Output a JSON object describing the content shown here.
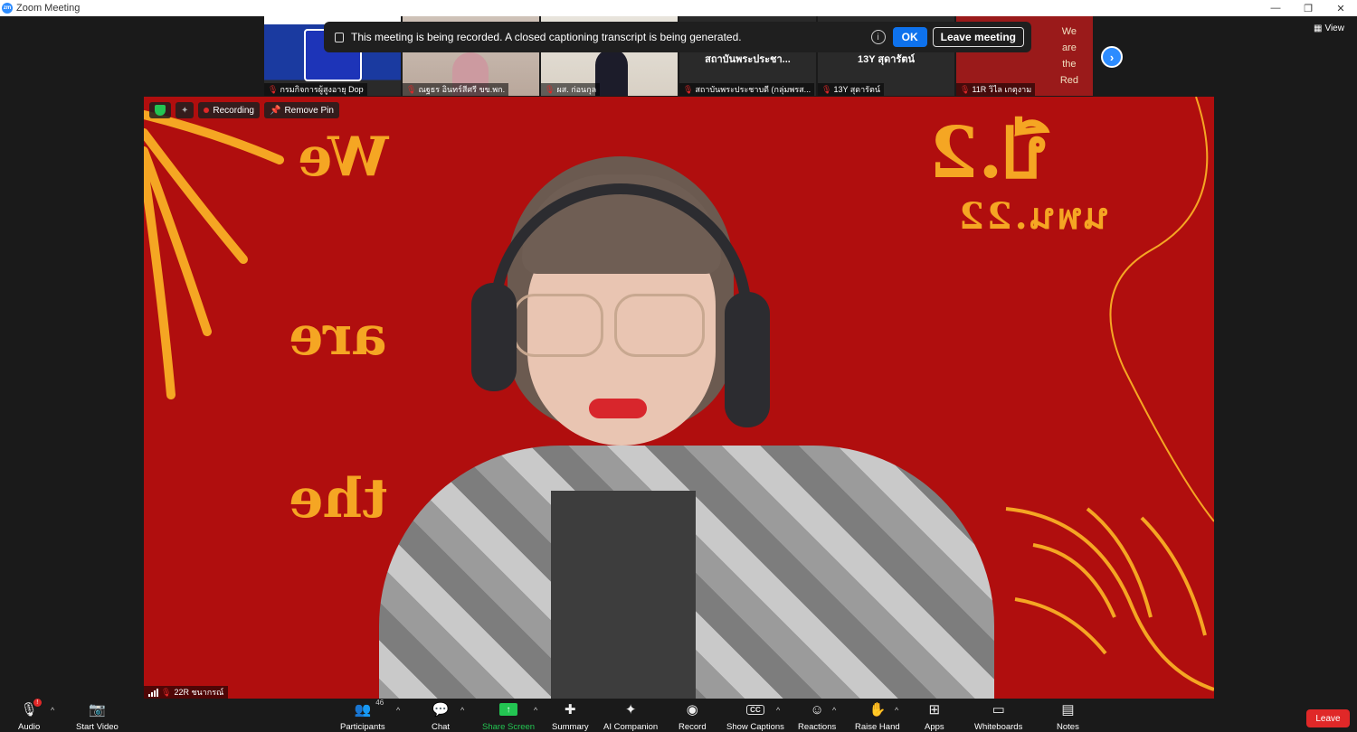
{
  "window": {
    "title": "Zoom Meeting",
    "app_icon_text": "zm",
    "controls": {
      "minimize": "—",
      "restore": "❐",
      "close": "✕"
    }
  },
  "recording_notice": {
    "message": "This meeting is being recorded. A closed captioning transcript is being generated.",
    "info_icon": "i",
    "ok_label": "OK",
    "leave_label": "Leave meeting"
  },
  "gallery": {
    "thumbnails": [
      {
        "name": "กรมกิจการผู้สูงอายุ Dop",
        "muted": true
      },
      {
        "name": "ณฐธร อินทร์สีศรี ขข.พก.",
        "muted": true
      },
      {
        "name": "ผส. ก่อนกุล",
        "muted": true
      },
      {
        "name": "สถาบันพระประชาบดี (กลุ่มพรส...",
        "muted": true,
        "big_name": "สถาบันพระประชา..."
      },
      {
        "name": "13Y สุดารัตน์",
        "muted": true,
        "big_name": "13Y สุดารัตน์"
      },
      {
        "name": "11R วิไล เกตุงาม",
        "muted": true,
        "overlay_text": [
          "We",
          "are",
          "the",
          "Red"
        ]
      }
    ],
    "next_icon": "›",
    "view_label": "View"
  },
  "main_video": {
    "background_words": [
      "We",
      "are",
      "the",
      "ปี.2",
      "นพน.22"
    ],
    "badges": {
      "recording_label": "Recording",
      "remove_pin_label": "Remove Pin"
    },
    "participant_name": "22R ชนากรณ์"
  },
  "toolbar": {
    "audio": {
      "label": "Audio",
      "icon": "🎙",
      "badge": "!"
    },
    "start_video": {
      "label": "Start Video",
      "icon": "📷"
    },
    "participants": {
      "label": "Participants",
      "icon": "👥",
      "count": "46"
    },
    "chat": {
      "label": "Chat",
      "icon": "💬"
    },
    "share_screen": {
      "label": "Share Screen",
      "icon": "↑"
    },
    "summary": {
      "label": "Summary",
      "icon": "✚"
    },
    "ai_companion": {
      "label": "AI Companion",
      "icon": "✦"
    },
    "record": {
      "label": "Record",
      "icon": "◉"
    },
    "show_captions": {
      "label": "Show Captions",
      "icon": "CC"
    },
    "reactions": {
      "label": "Reactions",
      "icon": "☺"
    },
    "raise_hand": {
      "label": "Raise Hand",
      "icon": "✋"
    },
    "apps": {
      "label": "Apps",
      "icon": "⊞"
    },
    "whiteboards": {
      "label": "Whiteboards",
      "icon": "▭"
    },
    "notes": {
      "label": "Notes",
      "icon": "▤"
    },
    "leave": {
      "label": "Leave"
    },
    "caret": "^"
  },
  "colors": {
    "accent": "#2d8cff",
    "danger": "#e02828",
    "share": "#23c552",
    "video_bg": "#b00e0e",
    "bg_text": "#f5a623"
  }
}
